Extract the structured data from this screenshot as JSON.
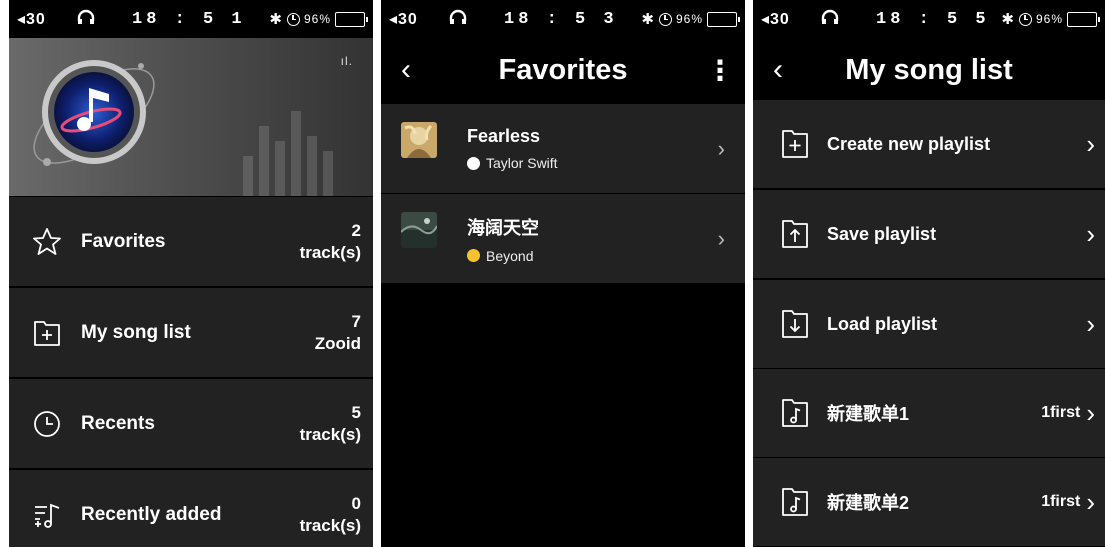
{
  "screen1": {
    "status": {
      "volume": "◂30",
      "time": "18 : 5 1",
      "battery": "96%"
    },
    "menu": [
      {
        "label": "Favorites",
        "count": "2",
        "unit": "track(s)",
        "icon": "star-icon"
      },
      {
        "label": "My song list",
        "count": "7",
        "unit": "Zooid",
        "icon": "folder-add-icon"
      },
      {
        "label": "Recents",
        "count": "5",
        "unit": "track(s)",
        "icon": "clock-icon"
      },
      {
        "label": "Recently added",
        "count": "0",
        "unit": "track(s)",
        "icon": "list-add-icon"
      }
    ]
  },
  "screen2": {
    "status": {
      "volume": "◂30",
      "time": "18 : 5 3",
      "battery": "96%"
    },
    "title": "Favorites",
    "tracks": [
      {
        "song": "Fearless",
        "artist": "Taylor Swift",
        "dot_color": "#ffffff"
      },
      {
        "song": "海阔天空",
        "artist": "Beyond",
        "dot_color": "#f6c230"
      }
    ]
  },
  "screen3": {
    "status": {
      "volume": "◂30",
      "time": "18 : 5 5",
      "battery": "96%"
    },
    "title": "My song list",
    "items": [
      {
        "label": "Create new playlist",
        "extra": "",
        "icon": "folder-plus-icon"
      },
      {
        "label": "Save playlist",
        "extra": "",
        "icon": "folder-upload-icon"
      },
      {
        "label": "Load playlist",
        "extra": "",
        "icon": "folder-download-icon"
      },
      {
        "label": "新建歌单1",
        "extra": "1first",
        "icon": "folder-music-icon"
      },
      {
        "label": "新建歌单2",
        "extra": "1first",
        "icon": "folder-music-icon"
      }
    ]
  }
}
